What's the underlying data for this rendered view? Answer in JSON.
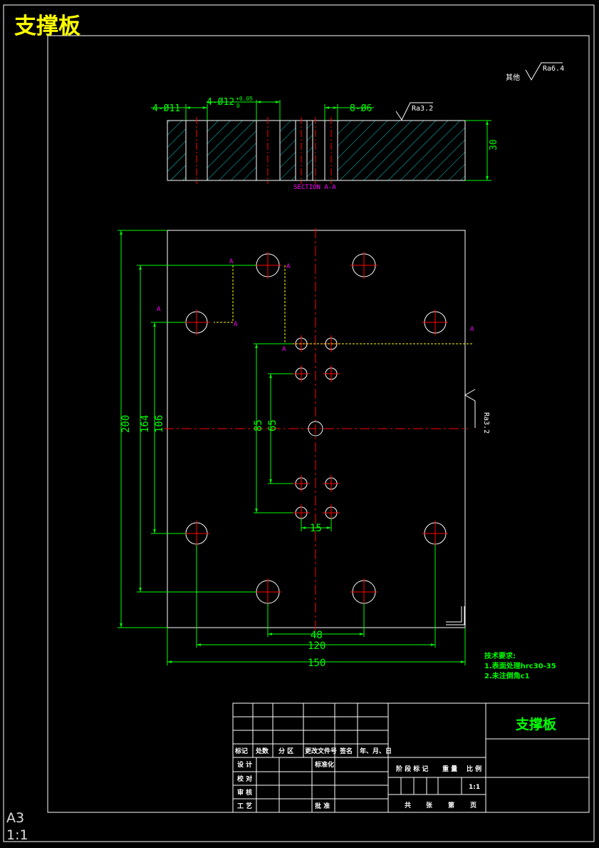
{
  "drawing": {
    "title_top": "支撑板",
    "sheet_size": "A3",
    "sheet_scale": "1:1",
    "colors": {
      "outline": "#ffffff",
      "dimension": "#00ff00",
      "centerline": "#ff0000",
      "section_label": "#ff00ff",
      "hatch": "#00c8c8",
      "title": "#ffff00",
      "hidden_line": "#ffff00"
    }
  },
  "section": {
    "label": "SECTION A-A",
    "dim_holes_11": "4-Ø11",
    "dim_holes_12": "4-Ø12",
    "dim_holes_12_tol": "+0.05",
    "dim_holes_12_tol_low": "0",
    "dim_holes_6": "8-Ø6",
    "dim_thickness": "30",
    "roughness_top": "Ra3.2"
  },
  "roughness_other": {
    "label": "其他",
    "value": "Ra6.4"
  },
  "plan": {
    "section_marker": "A",
    "dim_200": "200",
    "dim_164": "164",
    "dim_106": "106",
    "dim_85": "85",
    "dim_65": "65",
    "dim_15": "15",
    "dim_48": "48",
    "dim_120": "120",
    "dim_150": "150",
    "roughness_side": "Ra3.2"
  },
  "notes": {
    "heading": "技术要求:",
    "line1": "1.表面处理hrc30-35",
    "line2": "2.未注倒角c1"
  },
  "title_block": {
    "part_name": "支撑板",
    "h_mark": "标记",
    "h_count": "处数",
    "h_zone": "分 区",
    "h_docno": "更改文件号",
    "h_sign": "签名",
    "h_date": "年、月、日",
    "r_design": "设 计",
    "r_standard": "标准化",
    "r_check": "校 对",
    "r_review": "审 核",
    "r_process": "工 艺",
    "r_approve": "批 准",
    "stage_mark": "阶 段 标 记",
    "weight": "重 量",
    "ratio_label": "比 例",
    "ratio_value": "1:1",
    "total": "共",
    "sheets": "张",
    "page_no": "第",
    "page": "页"
  }
}
